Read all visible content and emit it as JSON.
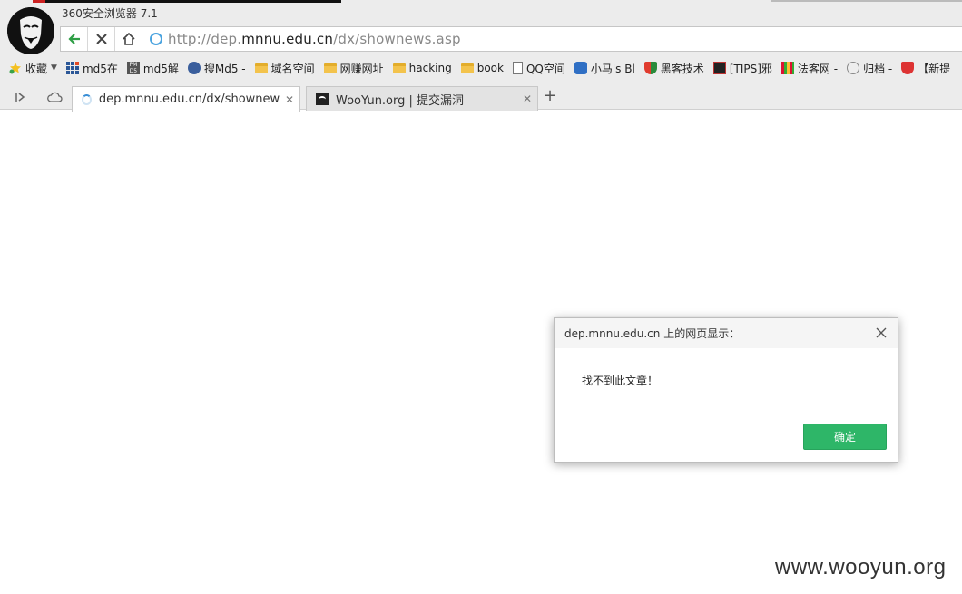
{
  "window": {
    "title": "360安全浏览器 7.1"
  },
  "address_bar": {
    "url_prefix": "http://dep.",
    "url_host": "mnnu.edu.cn",
    "url_path": "/dx/shownews.asp"
  },
  "bookmarks": [
    {
      "label": "收藏",
      "icon": "star-icon"
    },
    {
      "label": "md5在",
      "icon": "grid-icon"
    },
    {
      "label": "md5解",
      "icon": "md5-icon"
    },
    {
      "label": "搜Md5 -",
      "icon": "globe-icon"
    },
    {
      "label": "域名空间",
      "icon": "folder-icon"
    },
    {
      "label": "网赚网址",
      "icon": "folder-icon"
    },
    {
      "label": "hacking",
      "icon": "folder-icon"
    },
    {
      "label": "book",
      "icon": "folder-icon"
    },
    {
      "label": "QQ空间",
      "icon": "page-icon"
    },
    {
      "label": "小马's Bl",
      "icon": "horse-icon"
    },
    {
      "label": "黑客技术",
      "icon": "shield-icon"
    },
    {
      "label": "[TIPS]邪",
      "icon": "tips-icon"
    },
    {
      "label": "法客网 -",
      "icon": "bars-icon"
    },
    {
      "label": "归档 -",
      "icon": "face-icon"
    },
    {
      "label": "【新提",
      "icon": "red-shield-icon"
    }
  ],
  "tabs": [
    {
      "label": "dep.mnnu.edu.cn/dx/shownews.asp",
      "active": true,
      "loading": true
    },
    {
      "label": "WooYun.org | 提交漏洞",
      "active": false
    }
  ],
  "dialog": {
    "title": "dep.mnnu.edu.cn 上的网页显示：",
    "message": "找不到此文章！",
    "ok_label": "确定",
    "ok_color": "#2eb668"
  },
  "watermark": "www.wooyun.org"
}
